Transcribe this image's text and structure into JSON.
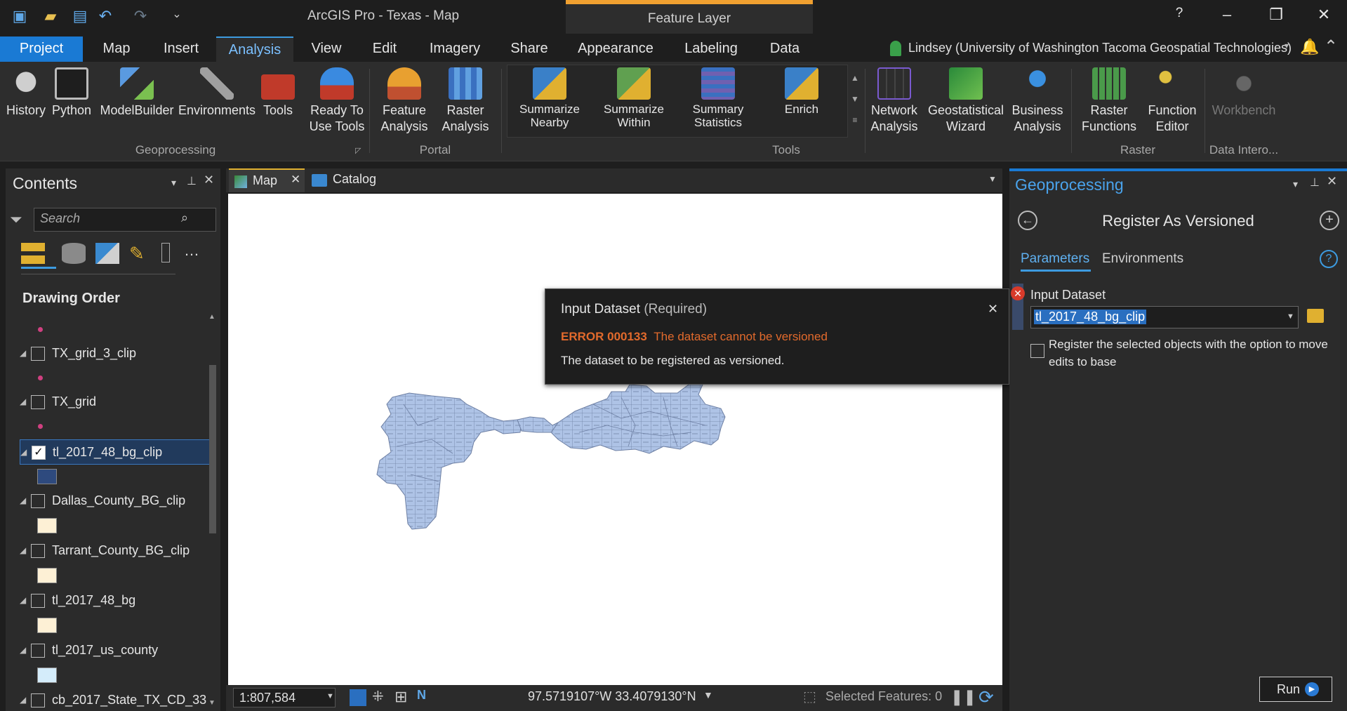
{
  "app": {
    "title": "ArcGIS Pro - Texas - Map",
    "context_header": "Feature Layer",
    "help": "?",
    "user": "Lindsey (University of Washington Tacoma Geospatial Technologies)"
  },
  "tabs": [
    "Project",
    "Map",
    "Insert",
    "Analysis",
    "View",
    "Edit",
    "Imagery",
    "Share",
    "Appearance",
    "Labeling",
    "Data"
  ],
  "ribbon": {
    "geoprocessing": {
      "label": "Geoprocessing",
      "buttons": [
        "History",
        "Python",
        "ModelBuilder",
        "Environments",
        "Tools",
        "Ready To\nUse Tools"
      ]
    },
    "portal": {
      "label": "Portal",
      "buttons": [
        "Feature\nAnalysis",
        "Raster\nAnalysis"
      ]
    },
    "tools": {
      "label": "Tools",
      "buttons": [
        "Summarize\nNearby",
        "Summarize\nWithin",
        "Summary\nStatistics",
        "Enrich"
      ]
    },
    "more": {
      "buttons": [
        "Network\nAnalysis",
        "Geostatistical\nWizard",
        "Business\nAnalysis"
      ]
    },
    "raster": {
      "label": "Raster",
      "buttons": [
        "Raster\nFunctions",
        "Function\nEditor"
      ]
    },
    "interop": {
      "label": "Data Intero...",
      "buttons": [
        "Workbench"
      ]
    }
  },
  "contents": {
    "title": "Contents",
    "search_placeholder": "Search",
    "drawing_order": "Drawing Order",
    "layers": [
      {
        "name": "TX_grid_3_clip",
        "checked": false
      },
      {
        "name": "TX_grid",
        "checked": false
      },
      {
        "name": "tl_2017_48_bg_clip",
        "checked": true
      },
      {
        "name": "Dallas_County_BG_clip",
        "checked": false
      },
      {
        "name": "Tarrant_County_BG_clip",
        "checked": false
      },
      {
        "name": "tl_2017_48_bg",
        "checked": false
      },
      {
        "name": "tl_2017_us_county",
        "checked": false
      },
      {
        "name": "cb_2017_State_TX_CD_33",
        "checked": false
      }
    ]
  },
  "map": {
    "tab_map": "Map",
    "tab_catalog": "Catalog",
    "scale": "1:807,584",
    "coords": "97.5719107°W 33.4079130°N",
    "selected": "Selected Features: 0"
  },
  "popup": {
    "title": "Input Dataset",
    "required": "(Required)",
    "error_code": "ERROR 000133",
    "error_msg": "The dataset cannot be versioned",
    "desc": "The dataset to be registered as versioned."
  },
  "gp": {
    "pane_title": "Geoprocessing",
    "tool_title": "Register As Versioned",
    "tab_params": "Parameters",
    "tab_env": "Environments",
    "input_label": "Input Dataset",
    "input_value": "tl_2017_48_bg_clip",
    "option_text": "Register the selected objects with the option to move edits to base",
    "run": "Run"
  }
}
